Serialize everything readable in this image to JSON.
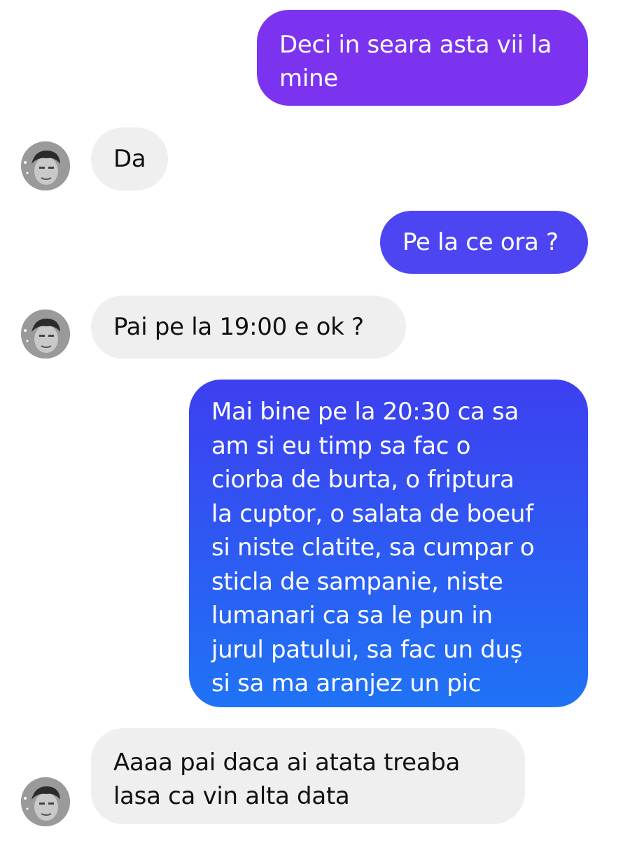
{
  "messages": [
    {
      "id": 1,
      "direction": "sent",
      "lines": [
        "Deci in seara asta vii la",
        "mine"
      ]
    },
    {
      "id": 2,
      "direction": "received",
      "lines": [
        "Da"
      ]
    },
    {
      "id": 3,
      "direction": "sent",
      "lines": [
        "Pe la ce ora ?"
      ]
    },
    {
      "id": 4,
      "direction": "received",
      "lines": [
        "Pai pe la 19:00  e ok ?"
      ]
    },
    {
      "id": 5,
      "direction": "sent",
      "lines": [
        "Mai bine pe la 20:30 ca sa",
        "am si eu timp sa fac o",
        "ciorba de burta, o friptura",
        "la cuptor, o salata de boeuf",
        "si niste clatite, sa cumpar o",
        "sticla de sampanie, niste",
        "lumanari ca sa le pun in",
        "jurul patului, sa fac un duș",
        "si sa ma aranjez un pic"
      ]
    },
    {
      "id": 6,
      "direction": "received",
      "lines": [
        "Aaaa pai daca ai atata treaba",
        "lasa ca vin alta data"
      ]
    }
  ],
  "colors": {
    "sent_purple": "#7c33f0",
    "sent_blue_violet": "#4d45f2",
    "sent_gradient_top": "#3d3ff0",
    "sent_gradient_bottom": "#1f73f5",
    "received_bg": "#efefef"
  },
  "avatar_icon": "contact-photo-icon"
}
